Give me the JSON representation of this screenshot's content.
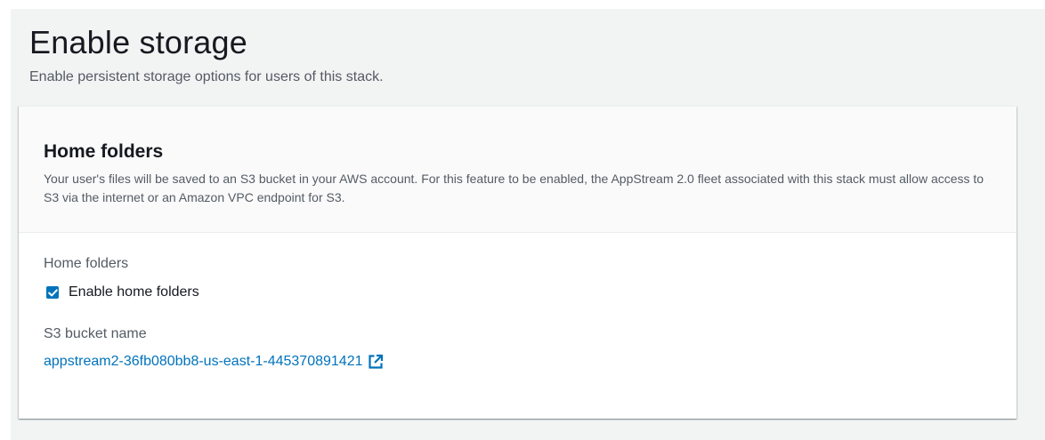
{
  "page": {
    "title": "Enable storage",
    "description": "Enable persistent storage options for users of this stack."
  },
  "home_folders_section": {
    "title": "Home folders",
    "description": "Your user's files will be saved to an S3 bucket in your AWS account. For this feature to be enabled, the AppStream 2.0 fleet associated with this stack must allow access to S3 via the internet or an Amazon VPC endpoint for S3.",
    "field_label": "Home folders",
    "checkbox": {
      "label": "Enable home folders",
      "checked": true
    },
    "bucket": {
      "label": "S3 bucket name",
      "name": "appstream2-36fb080bb8-us-east-1-445370891421",
      "icon": "external-link-icon"
    }
  },
  "colors": {
    "background": "#f2f3f3",
    "accent": "#0073bb",
    "heading": "#16191f",
    "secondary_text": "#545b64"
  }
}
